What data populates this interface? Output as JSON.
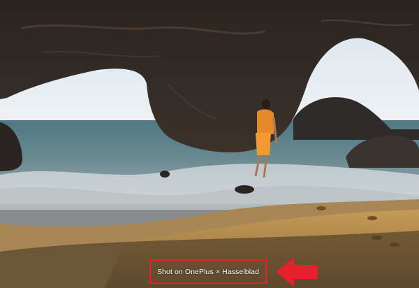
{
  "image": {
    "description_kind": "photo",
    "watermark": {
      "text": "Shot on OnePlus × Hasselblad"
    },
    "annotation": {
      "highlight_color": "#e3222b",
      "arrow_icon": "arrow-left-icon"
    }
  }
}
